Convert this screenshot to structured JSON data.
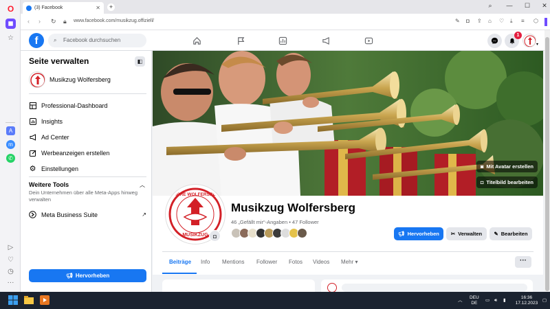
{
  "browser": {
    "tab_title": "(3) Facebook",
    "url": "www.facebook.com/musikzug.offiziell/",
    "new_tab": "+",
    "tab_close": "✕"
  },
  "header": {
    "search_placeholder": "Facebook durchsuchen",
    "notification_count": "1"
  },
  "sidebar": {
    "title": "Seite verwalten",
    "page_name": "Musikzug Wolfersberg",
    "items": [
      {
        "label": "Professional-Dashboard",
        "icon": "dashboard-icon"
      },
      {
        "label": "Insights",
        "icon": "insights-icon"
      },
      {
        "label": "Ad Center",
        "icon": "megaphone-icon"
      },
      {
        "label": "Werbeanzeigen erstellen",
        "icon": "edit-icon"
      },
      {
        "label": "Einstellungen",
        "icon": "gear-icon"
      }
    ],
    "tools_title": "Weitere Tools",
    "tools_desc": "Dein Unternehmen über alle Meta-Apps hinweg verwalten",
    "meta_suite": "Meta Business Suite",
    "boost_label": "Hervorheben"
  },
  "cover": {
    "avatar_button": "Mit Avatar erstellen",
    "edit_cover_button": "Titelbild bearbeiten"
  },
  "profile": {
    "name": "Musikzug Wolfersberg",
    "stats": "46 „Gefällt mir“-Angaben • 47 Follower",
    "logo_text_top": "PFARRE WOLFERSBERG",
    "logo_text_bottom": "MUSIKZUG",
    "buttons": {
      "boost": "Hervorheben",
      "manage": "Verwalten",
      "edit": "Bearbeiten"
    },
    "tabs": [
      "Beiträge",
      "Info",
      "Mentions",
      "Follower",
      "Fotos",
      "Videos",
      "Mehr ▾"
    ],
    "more": "···"
  },
  "taskbar": {
    "lang_top": "DEU",
    "lang_bottom": "DE",
    "time": "16:36",
    "date": "17.12.2023"
  },
  "colors": {
    "fb_blue": "#1877f2",
    "opera_red": "#ff1b2d",
    "badge_red": "#e41e3f"
  }
}
